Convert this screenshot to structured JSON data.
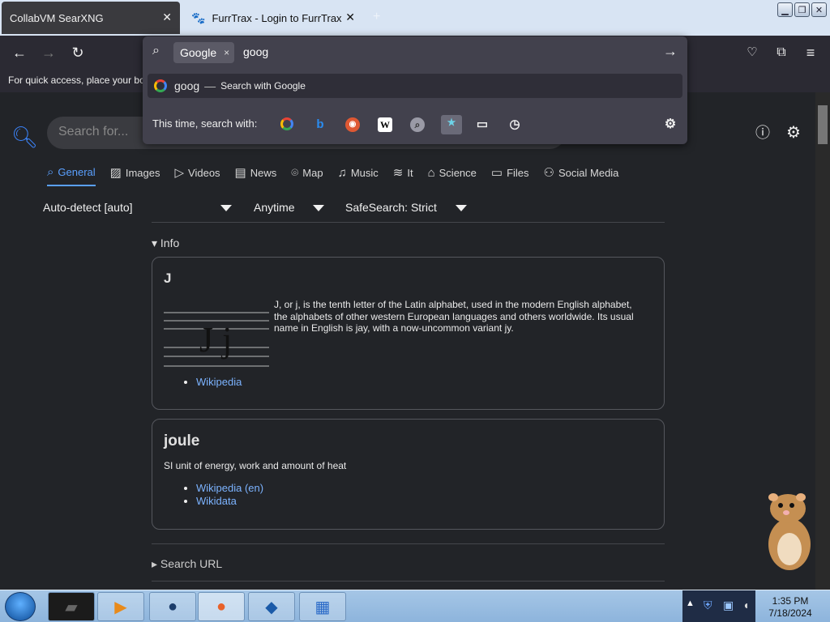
{
  "browser": {
    "tabs": [
      {
        "label": "CollabVM SearXNG",
        "active": true
      },
      {
        "label": "FurrTrax - Login to FurrTrax",
        "active": false
      }
    ],
    "new_tab": "+",
    "bookmarks_text": "For quick access, place your boo"
  },
  "urlbar": {
    "engine_chip": "Google",
    "chip_close": "×",
    "typed": "goog",
    "suggestion_query": "goog",
    "suggestion_dash": "—",
    "suggestion_action": "Search with Google",
    "one_off_label": "This time, search with:"
  },
  "page": {
    "search_placeholder": "Search for...",
    "categories": [
      {
        "label": "General",
        "icon": "search-icon",
        "active": true
      },
      {
        "label": "Images",
        "icon": "image-icon"
      },
      {
        "label": "Videos",
        "icon": "play-icon"
      },
      {
        "label": "News",
        "icon": "newspaper-icon"
      },
      {
        "label": "Map",
        "icon": "map-pin-icon"
      },
      {
        "label": "Music",
        "icon": "music-icon"
      },
      {
        "label": "It",
        "icon": "layers-icon"
      },
      {
        "label": "Science",
        "icon": "science-icon"
      },
      {
        "label": "Files",
        "icon": "files-icon"
      },
      {
        "label": "Social Media",
        "icon": "people-icon"
      }
    ],
    "filters": {
      "language": "Auto-detect [auto]",
      "time": "Anytime",
      "safesearch": "SafeSearch: Strict"
    },
    "info_label": "▾ Info",
    "cards": [
      {
        "title": "J",
        "text": "J, or j, is the tenth letter of the Latin alphabet, used in the modern English alphabet, the alphabets of other western European languages and others worldwide. Its usual name in English is jay, with a now-uncommon variant jy.",
        "image_glyph": "J j",
        "links": [
          "Wikipedia"
        ]
      },
      {
        "title": "joule",
        "text": "SI unit of energy, work and amount of heat",
        "links": [
          "Wikipedia (en)",
          "Wikidata"
        ]
      }
    ],
    "search_url_label": "▸ Search URL"
  },
  "taskbar": {
    "clock_time": "1:35 PM",
    "clock_date": "7/18/2024"
  },
  "colors": {
    "accent": "#5aa0ff",
    "link": "#7cb3ff",
    "page_bg": "#222428",
    "toolbar_bg": "#2b2a33"
  }
}
